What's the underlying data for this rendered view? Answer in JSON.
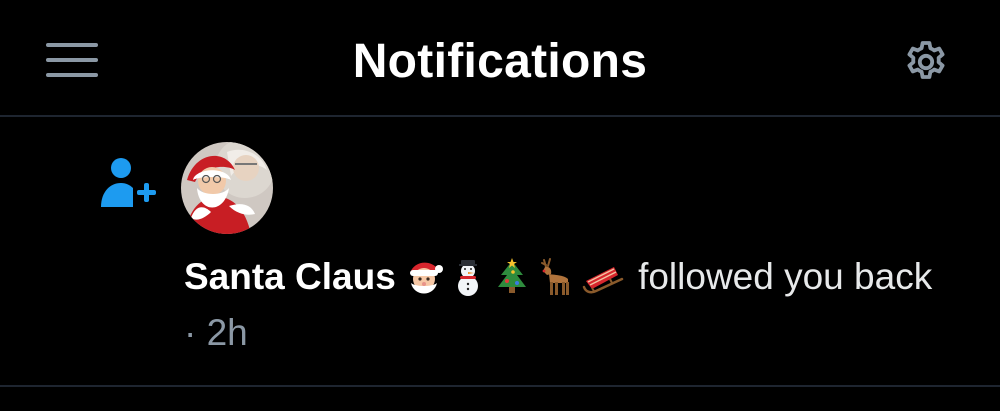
{
  "header": {
    "title": "Notifications",
    "menu_icon": "hamburger-menu-icon",
    "settings_icon": "gear-icon"
  },
  "notification": {
    "type_icon": "person-plus-icon",
    "type_icon_color": "#1d9bf0",
    "avatar": "santa-claus-avatar",
    "user_name": "Santa Claus",
    "name_emojis": [
      "santa-emoji",
      "snowman-emoji",
      "christmas-tree-emoji",
      "deer-emoji",
      "sled-emoji"
    ],
    "action_text": "followed you back",
    "separator": "·",
    "time_ago": "2h"
  },
  "colors": {
    "background": "#000000",
    "text": "#e7e9ea",
    "muted": "#8b98a5",
    "accent": "#1d9bf0",
    "divider": "#1e2530"
  }
}
